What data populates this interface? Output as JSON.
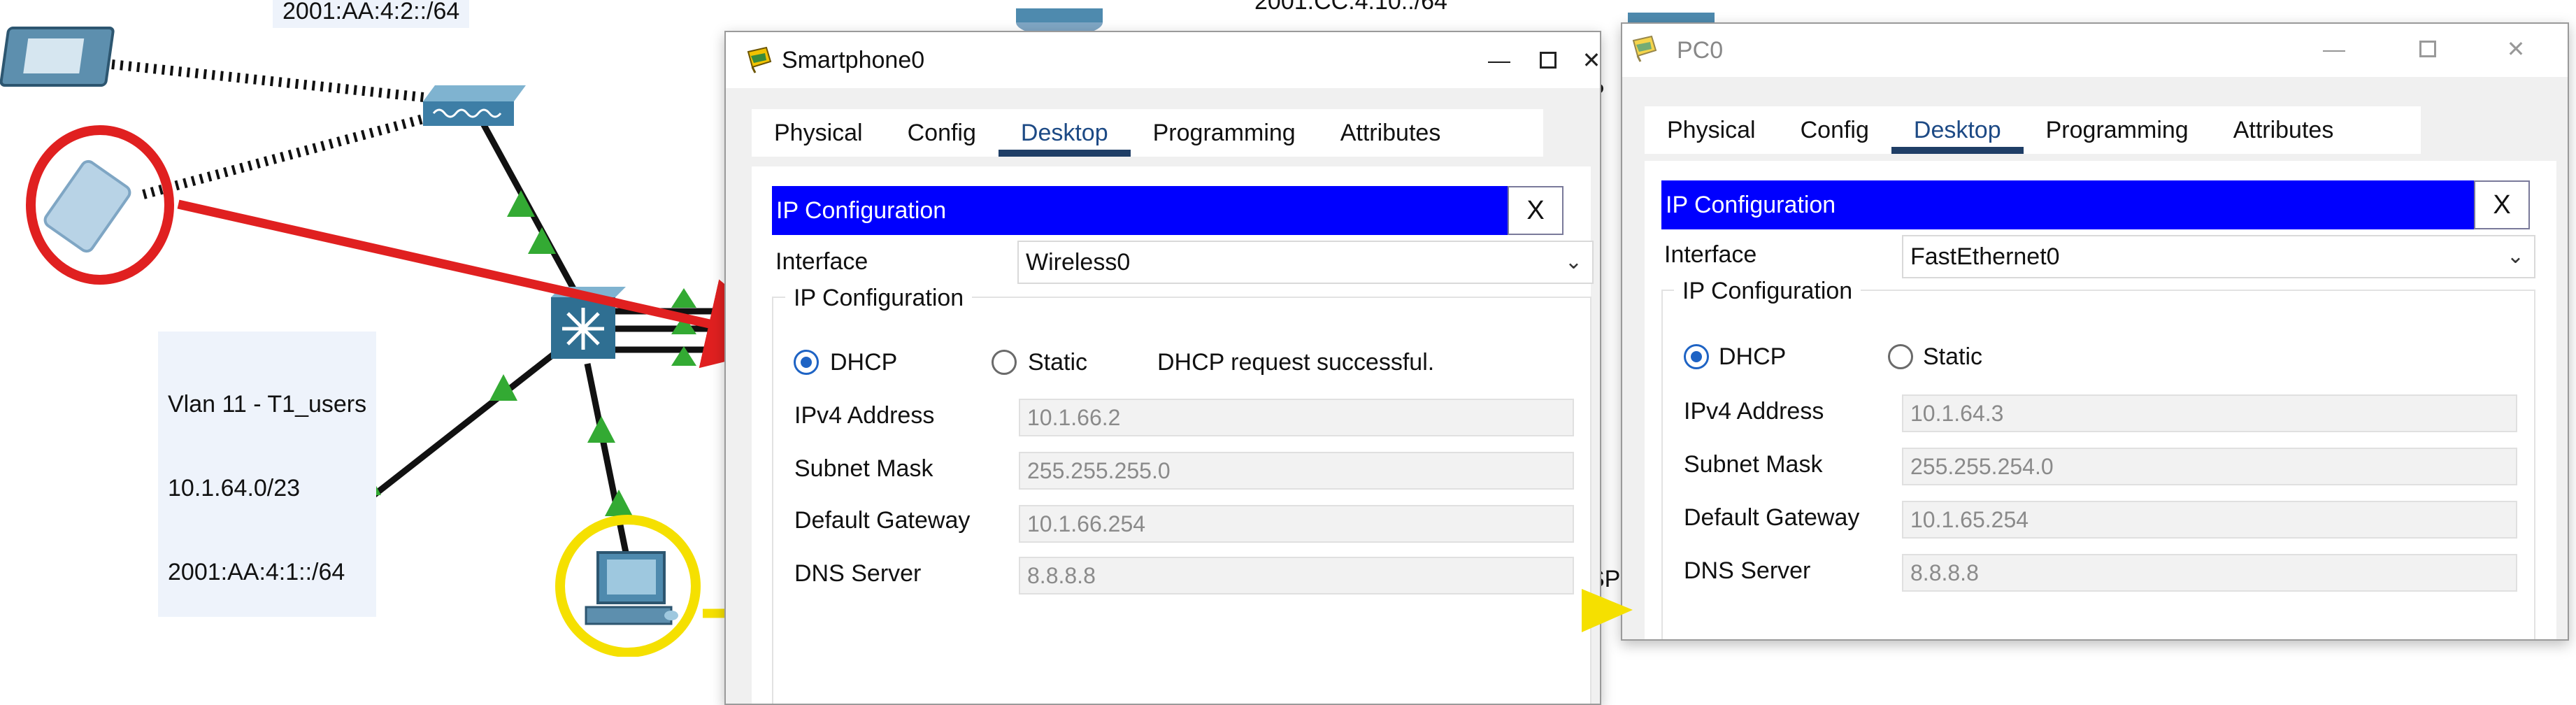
{
  "topology": {
    "top_label": "2001:AA:4:2::/64",
    "vlan_label": [
      "Vlan 11 - T1_users",
      "10.1.64.0/23",
      "2001:AA:4:1::/64"
    ],
    "behind_label_1": "2001:CC:4:10::/64",
    "behind_text_p": "P",
    "behind_text_sp": "SP",
    "accent_red": "#e02020",
    "accent_yellow": "#f5e000",
    "link_ok_color": "#33aa33"
  },
  "window1": {
    "title": "Smartphone0",
    "icon": "packet-tracer-icon",
    "tabs": [
      "Physical",
      "Config",
      "Desktop",
      "Programming",
      "Attributes"
    ],
    "active_tab": "Desktop",
    "ip_bar_title": "IP Configuration",
    "close_x": "X",
    "interface_label": "Interface",
    "interface_value": "Wireless0",
    "group_title": "IP Configuration",
    "dhcp_label": "DHCP",
    "static_label": "Static",
    "status_text": "DHCP request successful.",
    "fields": [
      {
        "label": "IPv4 Address",
        "value": "10.1.66.2"
      },
      {
        "label": "Subnet Mask",
        "value": "255.255.255.0"
      },
      {
        "label": "Default Gateway",
        "value": "10.1.66.254"
      },
      {
        "label": "DNS Server",
        "value": "8.8.8.8"
      }
    ]
  },
  "window2": {
    "title": "PC0",
    "icon": "packet-tracer-icon",
    "tabs": [
      "Physical",
      "Config",
      "Desktop",
      "Programming",
      "Attributes"
    ],
    "active_tab": "Desktop",
    "ip_bar_title": "IP Configuration",
    "close_x": "X",
    "interface_label": "Interface",
    "interface_value": "FastEthernet0",
    "group_title": "IP Configuration",
    "dhcp_label": "DHCP",
    "static_label": "Static",
    "fields": [
      {
        "label": "IPv4 Address",
        "value": "10.1.64.3"
      },
      {
        "label": "Subnet Mask",
        "value": "255.255.254.0"
      },
      {
        "label": "Default Gateway",
        "value": "10.1.65.254"
      },
      {
        "label": "DNS Server",
        "value": "8.8.8.8"
      }
    ]
  }
}
